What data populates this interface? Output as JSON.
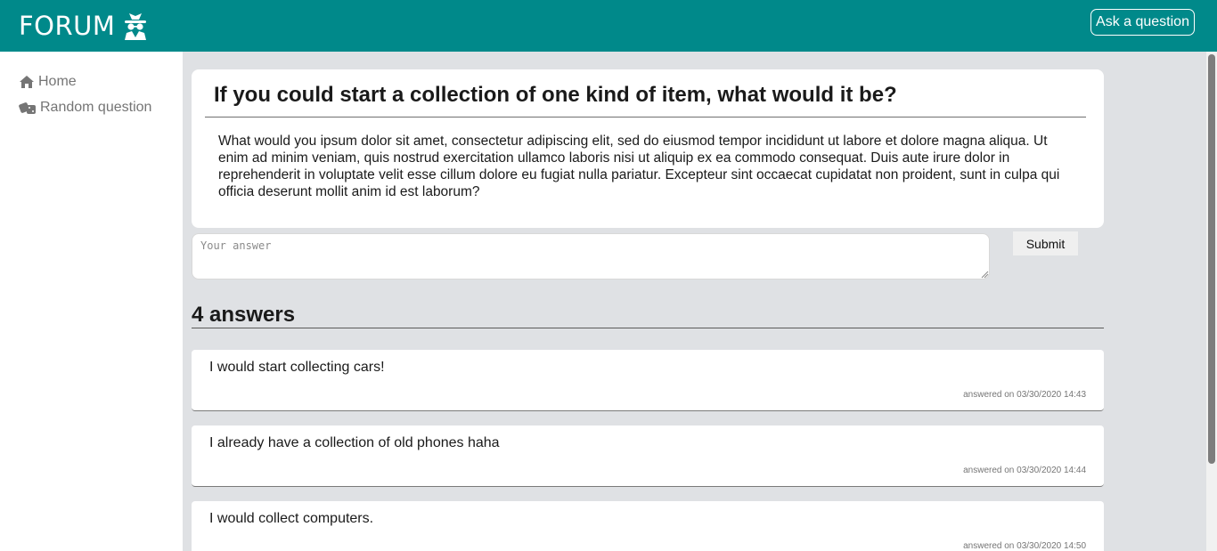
{
  "header": {
    "brand": "FORUM",
    "brand_icon": "spy-icon",
    "ask_button": "Ask a question",
    "color": "#00898a"
  },
  "sidebar": {
    "items": [
      {
        "label": "Home",
        "icon": "home-icon"
      },
      {
        "label": "Random question",
        "icon": "dice-icon"
      }
    ]
  },
  "question": {
    "title": "If you could start a collection of one kind of item, what would it be?",
    "body": "What would you ipsum dolor sit amet, consectetur adipiscing elit, sed do eiusmod tempor incididunt ut labore et dolore magna aliqua. Ut enim ad minim veniam, quis nostrud exercitation ullamco laboris nisi ut aliquip ex ea commodo consequat. Duis aute irure dolor in reprehenderit in voluptate velit esse cillum dolore eu fugiat nulla pariatur. Excepteur sint occaecat cupidatat non proident, sunt in culpa qui officia deserunt mollit anim id est laborum?"
  },
  "answer_form": {
    "placeholder": "Your answer",
    "value": "",
    "submit_label": "Submit"
  },
  "answers": {
    "heading": "4 answers",
    "items": [
      {
        "text": "I would start collecting cars!",
        "date": "answered on 03/30/2020 14:43"
      },
      {
        "text": "I already have a collection of old phones haha",
        "date": "answered on 03/30/2020 14:44"
      },
      {
        "text": "I would collect computers.",
        "date": "answered on 03/30/2020 14:50"
      }
    ]
  }
}
